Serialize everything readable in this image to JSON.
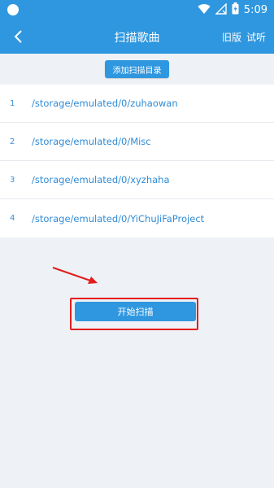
{
  "status_bar": {
    "time": "5:09",
    "icons": [
      "circle-dot",
      "wifi-icon",
      "no-signal-icon",
      "battery-charging-icon"
    ]
  },
  "header": {
    "back_icon": "chevron-left-icon",
    "title": "扫描歌曲",
    "actions": [
      "旧版",
      "试听"
    ]
  },
  "main": {
    "add_dir_label": "添加扫描目录",
    "directories": [
      {
        "index": "1",
        "path": "/storage/emulated/0/zuhaowan"
      },
      {
        "index": "2",
        "path": "/storage/emulated/0/Misc"
      },
      {
        "index": "3",
        "path": "/storage/emulated/0/xyzhaha"
      },
      {
        "index": "4",
        "path": "/storage/emulated/0/YiChuJiFaProject"
      }
    ],
    "scan_button_label": "开始扫描"
  },
  "colors": {
    "primary": "#2f97df",
    "link": "#2f8bd6",
    "annotation_red": "#e21d1d",
    "background": "#eef1f5"
  }
}
